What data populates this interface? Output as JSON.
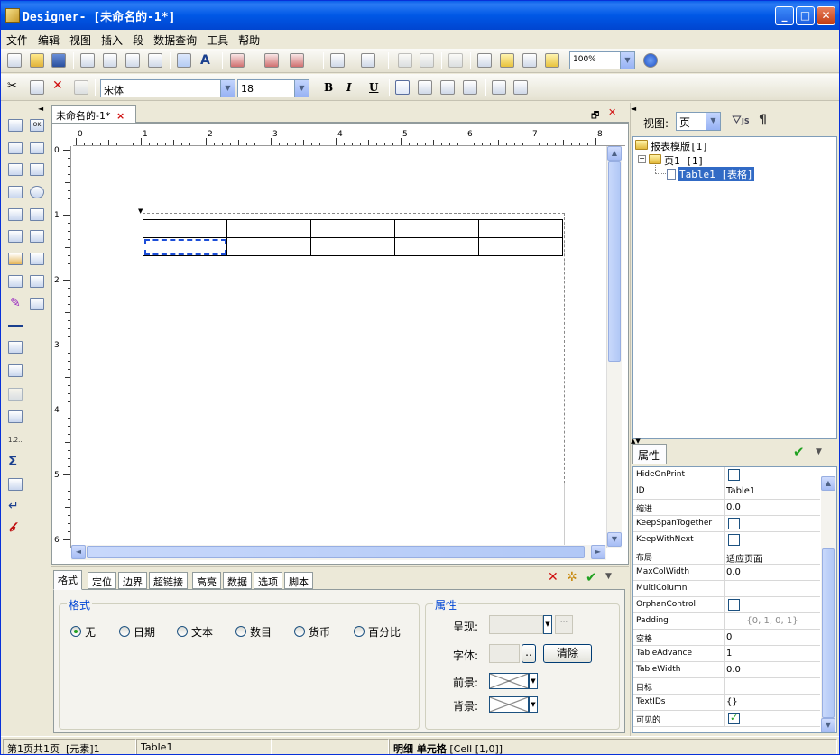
{
  "window": {
    "title": "Designer- [未命名的-1*]"
  },
  "menu": [
    "文件",
    "编辑",
    "视图",
    "插入",
    "段",
    "数据查询",
    "工具",
    "帮助"
  ],
  "toolbar": {
    "zoom": "100%"
  },
  "format_bar": {
    "font": "宋体",
    "size": "18",
    "bold": "B",
    "italic": "I",
    "underline": "U"
  },
  "document": {
    "tab": "未命名的-1*",
    "tab_close": "×",
    "ruler_h": [
      "0",
      "1",
      "2",
      "3",
      "4",
      "5",
      "6",
      "7",
      "8"
    ],
    "ruler_v": [
      "0",
      "1",
      "2",
      "3",
      "4",
      "5",
      "6"
    ]
  },
  "bottom": {
    "tabs": [
      "格式",
      "定位",
      "边界",
      "超链接",
      "高亮",
      "数据",
      "选项",
      "脚本"
    ],
    "format_group": "格式",
    "radios": [
      "无",
      "日期",
      "文本",
      "数目",
      "货币",
      "百分比"
    ],
    "props_group": "属性",
    "present_label": "呈现:",
    "font_label": "字体:",
    "font_btn": "..",
    "clear_btn": "清除",
    "fg_label": "前景:",
    "bg_label": "背景:"
  },
  "right": {
    "view_label": "视图:",
    "view_value": "页",
    "tree": [
      "报表模版[1]",
      "页1 [1]",
      "Table1 [表格]"
    ],
    "props_tab": "属性",
    "properties": [
      {
        "k": "HideOnPrint",
        "v": "",
        "chk": false
      },
      {
        "k": "ID",
        "v": "Table1"
      },
      {
        "k": "缩进",
        "v": "0.0"
      },
      {
        "k": "KeepSpanTogether",
        "v": "",
        "chk": false
      },
      {
        "k": "KeepWithNext",
        "v": "",
        "chk": false
      },
      {
        "k": "布局",
        "v": "适应页面"
      },
      {
        "k": "MaxColWidth",
        "v": "0.0"
      },
      {
        "k": "MultiColumn",
        "v": ""
      },
      {
        "k": "OrphanControl",
        "v": "",
        "chk": false
      },
      {
        "k": "Padding",
        "v": "{0, 1, 0, 1}"
      },
      {
        "k": "空格",
        "v": "0"
      },
      {
        "k": "TableAdvance",
        "v": "1"
      },
      {
        "k": "TableWidth",
        "v": "0.0"
      },
      {
        "k": "目标",
        "v": ""
      },
      {
        "k": "TextIDs",
        "v": "{}"
      },
      {
        "k": "可见的",
        "v": "",
        "chk": true
      }
    ]
  },
  "status": {
    "page": "第1页共1页",
    "element": "[元素]1",
    "name": "Table1",
    "cell_bold": "明细 单元格",
    "cell": "[Cell [1,0]]"
  }
}
